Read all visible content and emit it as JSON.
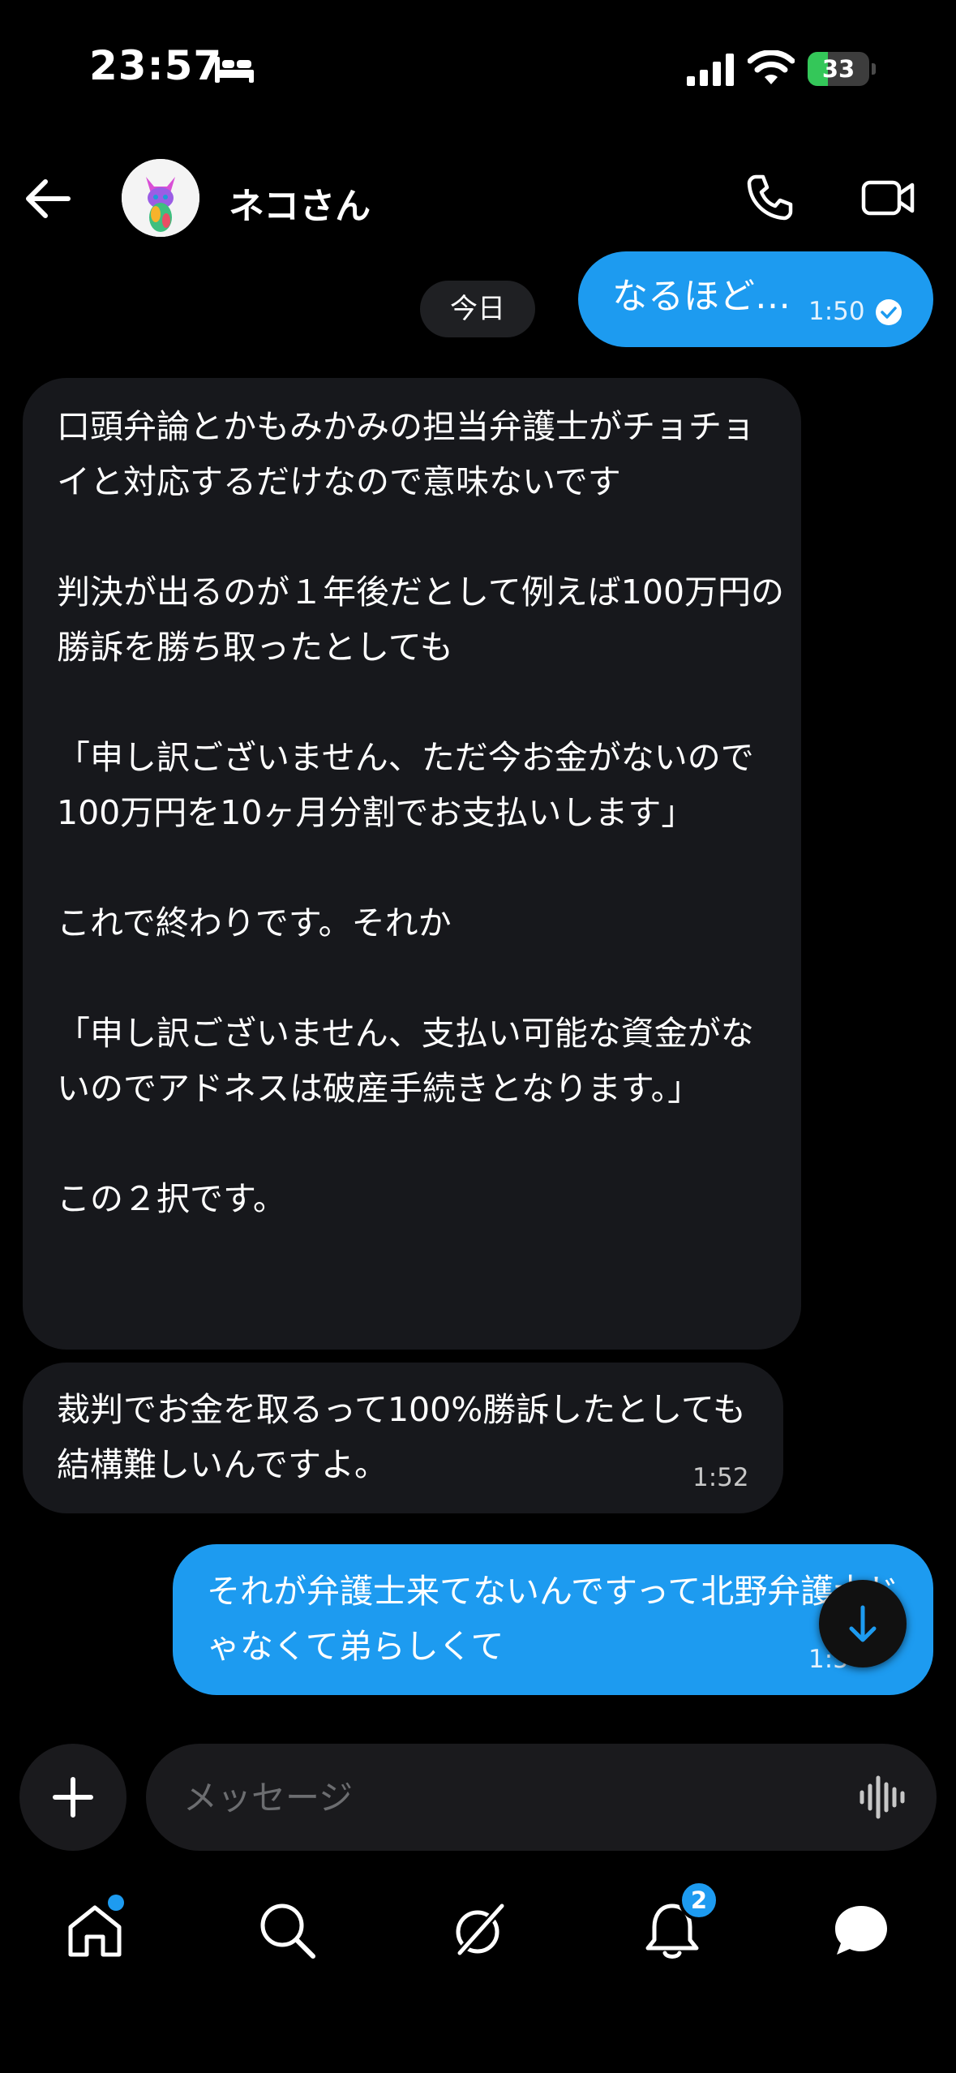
{
  "status_bar": {
    "time": "23:57",
    "battery_level": "33",
    "battery_fraction": 0.33,
    "battery_color": "#34c759"
  },
  "header": {
    "back_icon": "arrow-left-icon",
    "contact_name": "ネコさん",
    "call_icon": "phone-icon",
    "video_icon": "video-camera-icon"
  },
  "chat": {
    "date_label": "今日",
    "messages": [
      {
        "direction": "outgoing",
        "text": "なるほど…",
        "time": "1:50",
        "status_icon": "read-check-icon"
      },
      {
        "direction": "incoming",
        "text": "口頭弁論とかもみかみの担当弁護士がチョチョイと対応するだけなので意味ないです\n\n判決が出るのが１年後だとして例えば100万円の勝訴を勝ち取ったとしても\n\n「申し訳ございません、ただ今お金がないので100万円を10ヶ月分割でお支払いします」\n\nこれで終わりです。それか\n\n「申し訳ございません、支払い可能な資金がないのでアドネスは破産手続きとなります。」\n\nこの２択です。"
      },
      {
        "direction": "incoming",
        "text": "裁判でお金を取るって100%勝訴したとしても結構難しいんですよ。",
        "time": "1:52"
      },
      {
        "direction": "outgoing",
        "text": "それが弁護士来てないんですって北野弁護士じゃなくて弟らしくて",
        "time": "1:5"
      }
    ]
  },
  "composer": {
    "plus_icon": "plus-icon",
    "placeholder": "メッセージ",
    "voice_icon": "voice-wave-icon"
  },
  "bottom_nav": {
    "items": [
      {
        "icon": "home-icon",
        "has_dot": true
      },
      {
        "icon": "search-icon"
      },
      {
        "icon": "grok-icon"
      },
      {
        "icon": "bell-icon",
        "badge": "2"
      },
      {
        "icon": "chat-bubble-icon"
      }
    ]
  },
  "colors": {
    "accent": "#1d9bf0",
    "incoming_bubble": "#17181c",
    "background": "#000000"
  }
}
